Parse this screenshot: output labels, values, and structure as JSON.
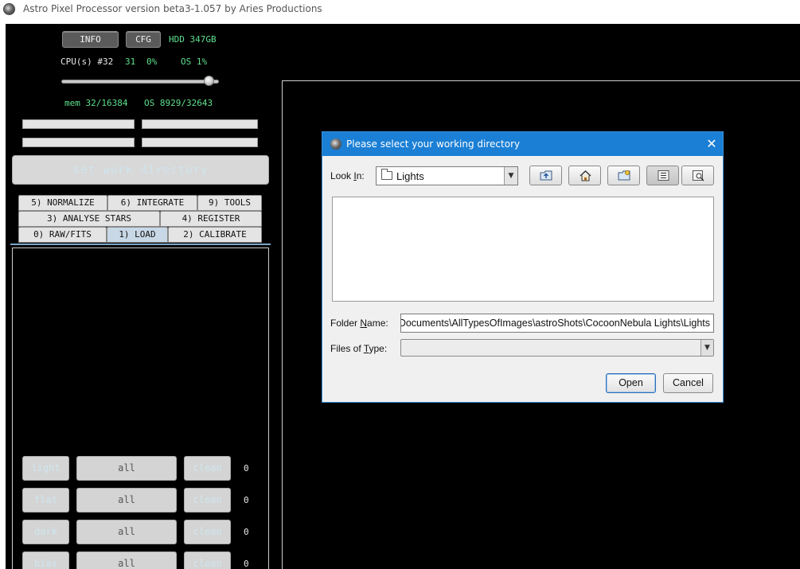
{
  "window": {
    "title": "Astro Pixel Processor version beta3-1.057 by Aries Productions"
  },
  "top_panel": {
    "info_label": "INFO",
    "cfg_label": "CFG",
    "hdd": "HDD 347GB",
    "cpu_label": "CPU(s) #32",
    "cpu_count": "31",
    "cpu_load": "0%",
    "os_load": "OS 1%",
    "slider_value": 0.94,
    "mem": "mem 32/16384",
    "os_mem": "OS 8929/32643",
    "set_work_directory": "set work directory"
  },
  "tabs": {
    "row1": [
      "5) NORMALIZE",
      "6) INTEGRATE",
      "9) TOOLS"
    ],
    "row2": [
      "3) ANALYSE STARS",
      "4) REGISTER"
    ],
    "row3": [
      "0) RAW/FITS",
      "1) LOAD",
      "2) CALIBRATE"
    ],
    "active": "1) LOAD"
  },
  "load_rows": [
    {
      "label": "light",
      "all": "all",
      "clean": "clean",
      "count": "0"
    },
    {
      "label": "flat",
      "all": "all",
      "clean": "clean",
      "count": "0"
    },
    {
      "label": "dark",
      "all": "all",
      "clean": "clean",
      "count": "0"
    },
    {
      "label": "bias",
      "all": "all",
      "clean": "clean",
      "count": "0"
    }
  ],
  "dialog": {
    "title": "Please select your working directory",
    "close_glyph": "✕",
    "look_in_label_pre": "Look ",
    "look_in_label_mnemonic": "I",
    "look_in_label_post": "n:",
    "look_in_value": "Lights",
    "toolbar_icons": [
      "up-one-level-icon",
      "home-icon",
      "new-folder-icon",
      "list-view-icon",
      "details-view-icon"
    ],
    "folder_name_label_pre": "Folder ",
    "folder_name_label_mnemonic": "N",
    "folder_name_label_post": "ame:",
    "folder_name_value": "C:\\Users\\Documents\\AllTypesOfImages\\astroShots\\CocoonNebula Lights\\Lights",
    "files_of_type_label_pre": "Files of ",
    "files_of_type_label_mnemonic": "T",
    "files_of_type_label_post": "ype:",
    "files_of_type_value": "",
    "open_label": "Open",
    "cancel_label": "Cancel"
  },
  "colors": {
    "app_background": "#000000",
    "status_green": "#5fe08c",
    "dialog_title_bar": "#1a7fd5",
    "dialog_body": "#f0f0f0"
  }
}
